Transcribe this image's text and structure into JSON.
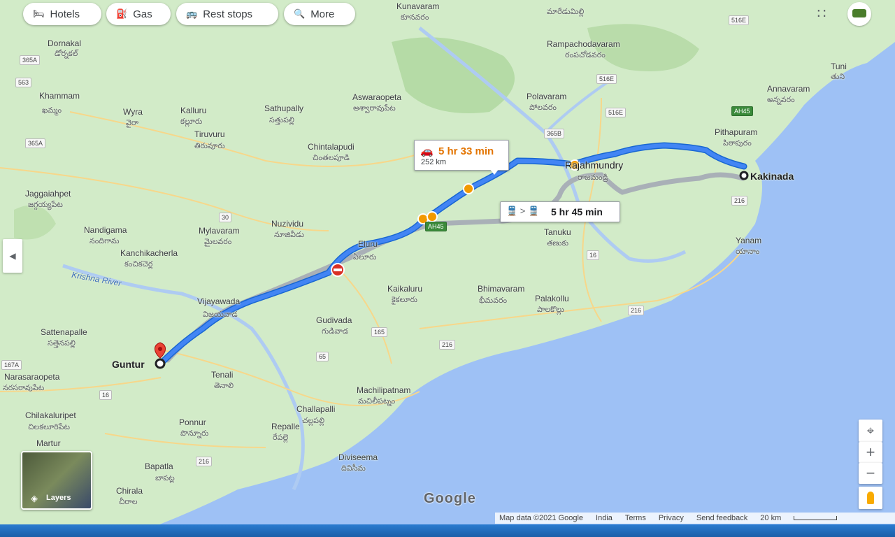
{
  "chips": [
    {
      "label": "Hotels",
      "icon": "bed-icon"
    },
    {
      "label": "Gas",
      "icon": "gas-station-icon"
    },
    {
      "label": "Rest stops",
      "icon": "rest-stop-icon"
    },
    {
      "label": "More",
      "icon": "search-icon"
    }
  ],
  "drive_card": {
    "duration": "5 hr 33 min",
    "distance": "252 km"
  },
  "transit_card": {
    "duration": "5 hr 45 min"
  },
  "labels": {
    "kakinada": "Kakinada",
    "guntur": "Guntur",
    "rajahmundry": "Rajahmundry",
    "rajahmundry_te": "రాజమండ్రి",
    "eluru": "Eluru",
    "eluru_te": "ఏలూరు",
    "vijayawada": "Vijayawada",
    "vijayawada_te": "విజయవాడ",
    "khammam": "Khammam",
    "khammam_te": "ఖమ్మం",
    "dornakal": "Dornakal",
    "dornakal_te": "డోర్నకల్",
    "wyra": "Wyra",
    "wyra_te": "వైరా",
    "kalluru": "Kalluru",
    "kalluru_te": "కల్లూరు",
    "sathupally": "Sathupally",
    "sathupally_te": "సత్తుపల్లి",
    "tiruvuru": "Tiruvuru",
    "tiruvuru_te": "తిరువూరు",
    "aswaraopeta": "Aswaraopeta",
    "aswaraopeta_te": "అశ్వారావుపేట",
    "chintalapudi": "Chintalapudi",
    "chintalapudi_te": "చింతలపూడి",
    "polavaram": "Polavaram",
    "polavaram_te": "పోలవరం",
    "rampachodavaram": "Rampachodavaram",
    "rampachodavaram_te": "రంపచోడవరం",
    "kunavaram": "Kunavaram",
    "kunavaram_te": "కూనవరం",
    "maredumilli_te": "మారేడుమిల్లి",
    "pithapuram": "Pithapuram",
    "pithapuram_te": "పిఠాపురం",
    "annavaram": "Annavaram",
    "annavaram_te": "అన్నవరం",
    "tuni": "Tuni",
    "tuni_te": "తుని",
    "jaggaiahpet": "Jaggaiahpet",
    "jaggaiahpet_te": "జగ్గయ్యపేట",
    "nandigama": "Nandigama",
    "nandigama_te": "నందిగామ",
    "kanchikacherla": "Kanchikacherla",
    "kanchikacherla_te": "కంచికచెర్ల",
    "mylavaram": "Mylavaram",
    "mylavaram_te": "మైలవరం",
    "nuzividu": "Nuzividu",
    "nuzividu_te": "నూజివీడు",
    "krishna_river": "Krishna River",
    "tanuku": "Tanuku",
    "tanuku_te": "తణుకు",
    "kaikaluru": "Kaikaluru",
    "kaikaluru_te": "కైకలూరు",
    "bhimavaram": "Bhimavaram",
    "bhimavaram_te": "భీమవరం",
    "palakollu": "Palakollu",
    "palakollu_te": "పాలకొల్లు",
    "yanam": "Yanam",
    "yanam_te": "యానాం",
    "gudivada": "Gudivada",
    "gudivada_te": "గుడివాడ",
    "sattenapalle": "Sattenapalle",
    "sattenapalle_te": "సత్తెనపల్లి",
    "narasaraopeta": "Narasaraopeta",
    "narasaraopeta_te": "నరసరావుపేట",
    "tenali": "Tenali",
    "tenali_te": "తెనాలి",
    "machilipatnam": "Machilipatnam",
    "machilipatnam_te": "మచిలీపట్నం",
    "challapalli": "Challapalli",
    "challapalli_te": "చల్లపల్లి",
    "chilakaluripet": "Chilakaluripet",
    "chilakaluripet_te": "చిలకలూరిపేట",
    "ponnur": "Ponnur",
    "ponnur_te": "పొన్నూరు",
    "repalle": "Repalle",
    "repalle_te": "రేపల్లె",
    "martur": "Martur",
    "bapatla": "Bapatla",
    "bapatla_te": "బాపట్ల",
    "chirala": "Chirala",
    "chirala_te": "చీరాల",
    "diviseema": "Diviseema",
    "diviseema_te": "దివిసీమ"
  },
  "highways": [
    "365A",
    "563",
    "365A",
    "30",
    "AH45",
    "16",
    "165",
    "65",
    "216",
    "216",
    "16",
    "216",
    "516E",
    "516E",
    "516E",
    "365B",
    "AH45",
    "216",
    "167A"
  ],
  "layers_label": "Layers",
  "google_logo": "Google",
  "footer": {
    "map_data": "Map data ©2021 Google",
    "india": "India",
    "terms": "Terms",
    "privacy": "Privacy",
    "feedback": "Send feedback",
    "scale": "20 km"
  },
  "colors": {
    "route": "#4285f4",
    "alt_route": "#9aa0a6",
    "sea": "#9ec1f5",
    "land": "#d2ebc8",
    "drive_time": "#e37400"
  }
}
